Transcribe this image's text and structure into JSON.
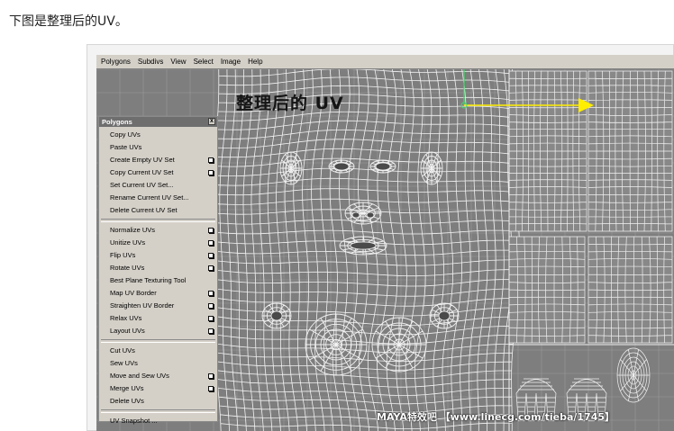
{
  "caption": "下图是整理后的UV。",
  "menubar": [
    "Polygons",
    "Subdivs",
    "View",
    "Select",
    "Image",
    "Help"
  ],
  "uv_title": "整理后的 UV",
  "panel": {
    "title": "Polygons",
    "close_label": "x",
    "groups": [
      [
        {
          "label": "Copy UVs",
          "option": false
        },
        {
          "label": "Paste UVs",
          "option": false
        },
        {
          "label": "Create Empty UV Set",
          "option": true
        },
        {
          "label": "Copy Current UV Set",
          "option": true
        },
        {
          "label": "Set Current UV Set...",
          "option": false
        },
        {
          "label": "Rename Current UV Set...",
          "option": false
        },
        {
          "label": "Delete Current UV Set",
          "option": false
        }
      ],
      [
        {
          "label": "Normalize UVs",
          "option": true
        },
        {
          "label": "Unitize UVs",
          "option": true
        },
        {
          "label": "Flip UVs",
          "option": true
        },
        {
          "label": "Rotate UVs",
          "option": true
        },
        {
          "label": "Best Plane Texturing Tool",
          "option": false
        },
        {
          "label": "Map UV Border",
          "option": true
        },
        {
          "label": "Straighten UV Border",
          "option": true
        },
        {
          "label": "Relax UVs",
          "option": true
        },
        {
          "label": "Layout UVs",
          "option": true
        }
      ],
      [
        {
          "label": "Cut UVs",
          "option": false
        },
        {
          "label": "Sew UVs",
          "option": false
        },
        {
          "label": "Move and Sew UVs",
          "option": true
        },
        {
          "label": "Merge UVs",
          "option": true
        },
        {
          "label": "Delete UVs",
          "option": false
        }
      ],
      [
        {
          "label": "UV Snapshot ...",
          "option": false
        }
      ]
    ]
  },
  "watermark": "MAYA特效吧 【www.linecg.com/tieba/1745】",
  "colors": {
    "editor_bg": "#7e7e7e",
    "wire": "#f2f2f2",
    "grid": "#9a9a9a",
    "manip_green": "#44d86a",
    "manip_yellow": "#ffee00",
    "panel_bg": "#d4d0c8"
  }
}
